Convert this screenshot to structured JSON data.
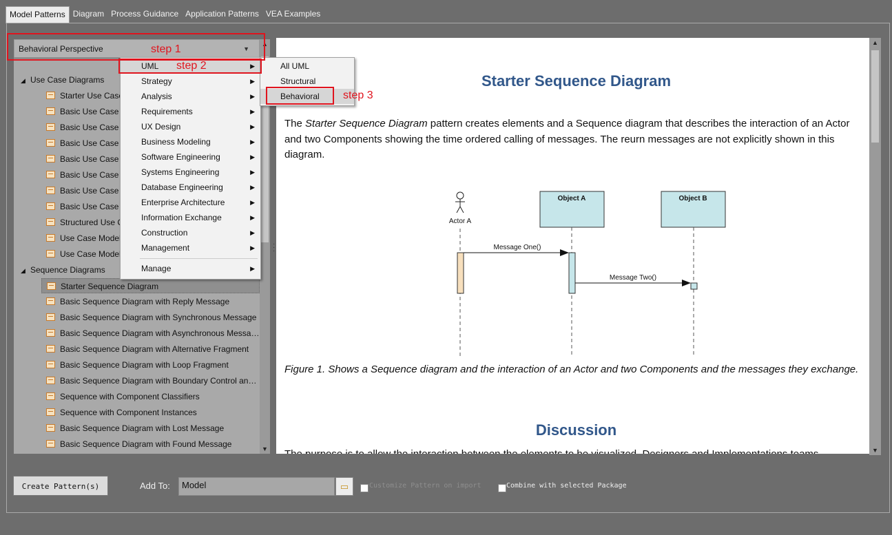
{
  "tabs": [
    "Model Patterns",
    "Diagram",
    "Process Guidance",
    "Application Patterns",
    "VEA Examples"
  ],
  "perspective": {
    "selected": "Behavioral Perspective"
  },
  "tree": {
    "groups": [
      {
        "label": "Use Case Diagrams",
        "items": [
          "Starter Use Case",
          "Basic Use Case M",
          "Basic Use Case M",
          "Basic Use Case M",
          "Basic Use Case M",
          "Basic Use Case M",
          "Basic Use Case M",
          "Basic Use Case M",
          "Structured Use C",
          "Use Case Model w",
          "Use Case Model w"
        ]
      },
      {
        "label": "Sequence Diagrams",
        "items": [
          "Starter Sequence Diagram",
          "Basic Sequence Diagram with Reply Message",
          "Basic Sequence Diagram with Synchronous Message",
          "Basic Sequence Diagram with Asynchronous Message",
          "Basic Sequence Diagram with Alternative Fragment",
          "Basic Sequence Diagram with Loop Fragment",
          "Basic Sequence Diagram with Boundary Control and ...",
          "Sequence with Component Classifiers",
          "Sequence with Component Instances",
          "Basic Sequence Diagram with Lost Message",
          "Basic Sequence Diagram with Found Message"
        ]
      }
    ],
    "selected_item": "Starter Sequence Diagram"
  },
  "menu": {
    "items": [
      "UML",
      "Strategy",
      "Analysis",
      "Requirements",
      "UX Design",
      "Business Modeling",
      "Software Engineering",
      "Systems Engineering",
      "Database Engineering",
      "Enterprise Architecture",
      "Information Exchange",
      "Construction",
      "Management",
      "Manage"
    ],
    "highlighted": "UML"
  },
  "submenu": {
    "items": [
      "All UML",
      "Structural",
      "Behavioral"
    ],
    "highlighted": "Behavioral"
  },
  "annotations": {
    "step1": "step 1",
    "step2": "step 2",
    "step3": "step 3",
    "color": "#e0141e"
  },
  "content": {
    "title": "Starter Sequence Diagram",
    "intro_before": "The ",
    "intro_italic": "Starter Sequence Diagram",
    "intro_after": " pattern creates elements and a Sequence diagram that describes the interaction of an Actor and two Components showing the time ordered calling of messages. The reurn messages are not explicitly shown in this diagram.",
    "figure": {
      "actor": "Actor A",
      "object_a": "Object A",
      "object_b": "Object B",
      "message_one": "Message One()",
      "message_two": "Message Two()"
    },
    "caption": "Figure 1. Shows a Sequence diagram and the interaction of an Actor and two Components and the messages they exchange.",
    "discussion_title": "Discussion",
    "discussion_text": "The purpose is to allow the interaction between the elements to be visualized. Designers and Implementations teams"
  },
  "footer": {
    "create_button": "Create Pattern(s)",
    "add_to_label": "Add To:",
    "add_to_value": "Model",
    "customize_label": "Customize Pattern on import",
    "combine_label": "Combine with selected Package"
  },
  "colors": {
    "accent_heading": "#31578a",
    "highlight_box": "#e0141e",
    "object_fill": "#c6e6ea",
    "actor_activation": "#f7dfbd"
  }
}
